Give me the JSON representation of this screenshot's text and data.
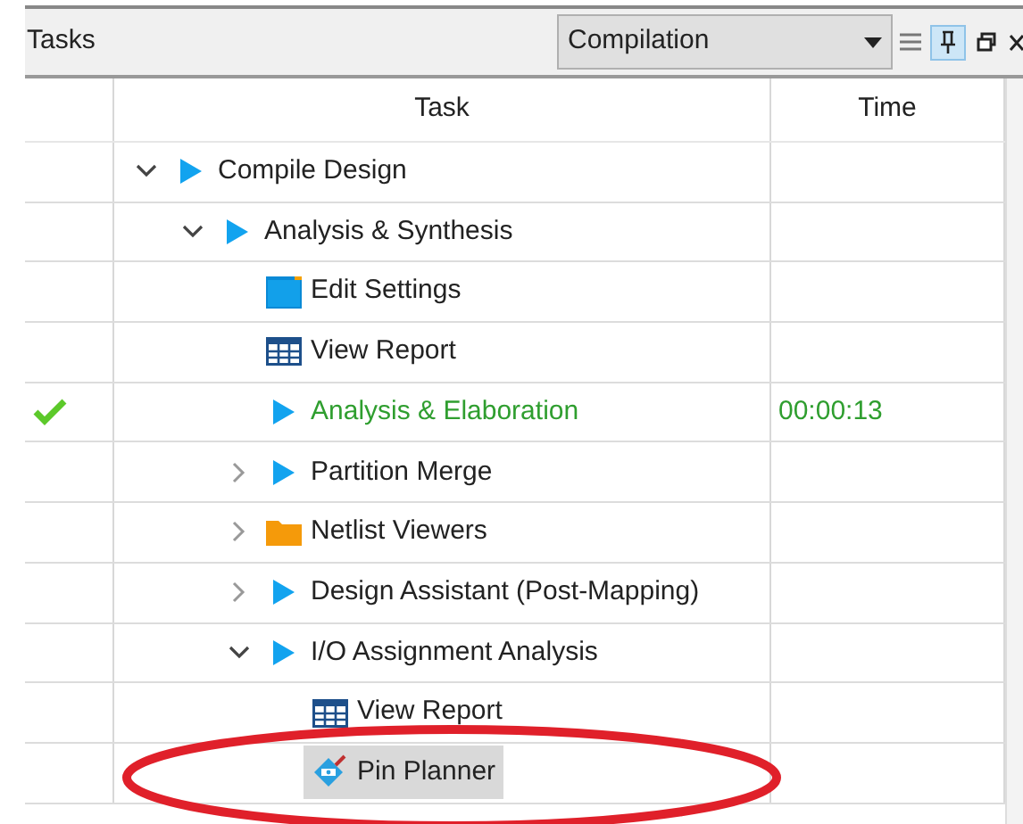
{
  "panel": {
    "title": "Tasks",
    "flow": {
      "value": "Compilation"
    },
    "pinned": true
  },
  "table": {
    "columns": [
      "Task",
      "Time"
    ],
    "rows": [
      {
        "label": "Compile Design",
        "kind": "run",
        "expanded": true,
        "selected": false,
        "completed": false,
        "children": [
          {
            "label": "Analysis & Synthesis",
            "kind": "run",
            "expanded": true,
            "selected": false,
            "completed": false,
            "children": [
              {
                "label": "Edit Settings",
                "kind": "settings",
                "selected": false,
                "completed": false
              },
              {
                "label": "View Report",
                "kind": "report",
                "selected": false,
                "completed": false
              },
              {
                "label": "Analysis & Elaboration",
                "kind": "run",
                "selected": false,
                "completed": true,
                "time": "00:00:13"
              },
              {
                "label": "Partition Merge",
                "kind": "run",
                "expanded": false,
                "selected": false,
                "completed": false
              },
              {
                "label": "Netlist Viewers",
                "kind": "folder",
                "expanded": false,
                "selected": false,
                "completed": false
              },
              {
                "label": "Design Assistant (Post-Mapping)",
                "kind": "run",
                "expanded": false,
                "selected": false,
                "completed": false
              },
              {
                "label": "I/O Assignment Analysis",
                "kind": "run",
                "expanded": true,
                "selected": false,
                "completed": false,
                "children": [
                  {
                    "label": "View Report",
                    "kind": "report",
                    "selected": false,
                    "completed": false
                  },
                  {
                    "label": "Pin Planner",
                    "kind": "pin-planner",
                    "selected": true,
                    "completed": false
                  }
                ]
              }
            ]
          }
        ]
      }
    ]
  },
  "annotation": {
    "kind": "ellipse",
    "color": "#e0202a"
  }
}
